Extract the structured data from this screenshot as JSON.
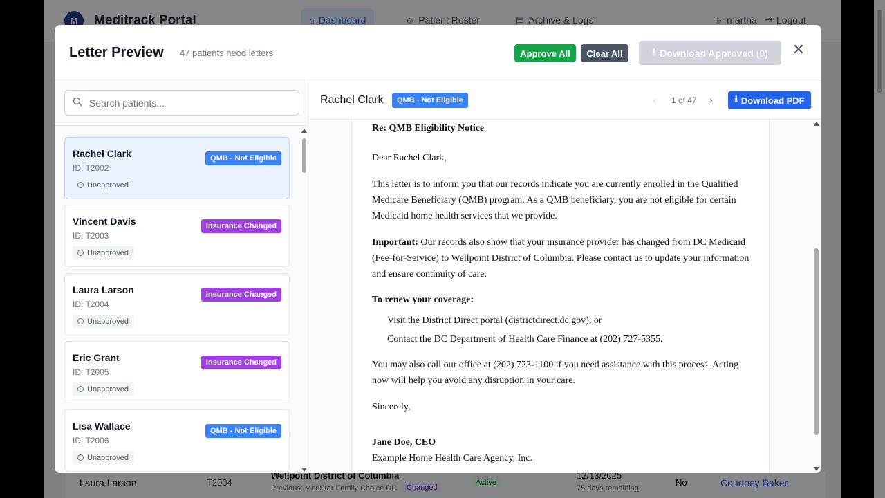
{
  "app": {
    "logo": "M",
    "title": "Meditrack Portal",
    "nav": [
      {
        "label": "Dashboard",
        "icon": "home-icon"
      },
      {
        "label": "Patient Roster",
        "icon": "user-icon"
      },
      {
        "label": "Archive & Logs",
        "icon": "archive-icon"
      }
    ],
    "user": "martha",
    "logout": "Logout",
    "bg_row": {
      "name": "Laura Larson",
      "id": "T2004",
      "insurance": "Wellpoint District of Columbia",
      "previous": "Previous: MedStar Family Choice DC",
      "changed": "Changed",
      "status": "Active",
      "date": "12/13/2025",
      "remaining": "75 days remaining",
      "flag": "No",
      "staff": "Courtney Baker"
    }
  },
  "modal": {
    "title": "Letter Preview",
    "subtitle": "47 patients need letters",
    "approve_all": "Approve All",
    "clear_all": "Clear All",
    "download_approved": "Download Approved (0)",
    "close": "✕"
  },
  "search": {
    "placeholder": "Search patients...",
    "value": ""
  },
  "patients": [
    {
      "name": "Rachel Clark",
      "id": "ID: T2002",
      "status": "Unapproved",
      "badge": "QMB - Not Eligible",
      "badge_color": "#3b82f6",
      "selected": true
    },
    {
      "name": "Vincent Davis",
      "id": "ID: T2003",
      "status": "Unapproved",
      "badge": "Insurance Changed",
      "badge_color": "#a23fe0",
      "selected": false
    },
    {
      "name": "Laura Larson",
      "id": "ID: T2004",
      "status": "Unapproved",
      "badge": "Insurance Changed",
      "badge_color": "#a23fe0",
      "selected": false
    },
    {
      "name": "Eric Grant",
      "id": "ID: T2005",
      "status": "Unapproved",
      "badge": "Insurance Changed",
      "badge_color": "#a23fe0",
      "selected": false
    },
    {
      "name": "Lisa Wallace",
      "id": "ID: T2006",
      "status": "Unapproved",
      "badge": "QMB - Not Eligible",
      "badge_color": "#3b82f6",
      "selected": false
    }
  ],
  "preview": {
    "name": "Rachel Clark",
    "badge": "QMB - Not Eligible",
    "page": "1 of 47",
    "download_pdf": "Download PDF",
    "letter": {
      "re": "Re: QMB Eligibility Notice",
      "greeting": "Dear Rachel Clark,",
      "p1": "This letter is to inform you that our records indicate you are currently enrolled in the Qualified Medicare Beneficiary (QMB) program. As a QMB beneficiary, you are not eligible for certain Medicaid home health services that we provide.",
      "important_label": "Important:",
      "important_text": " Our records also show that your insurance provider has changed from DC Medicaid (Fee-for-Service) to Wellpoint District of Columbia. Please contact us to update your information and ensure continuity of care.",
      "renew_heading": "To renew your coverage:",
      "renew_1": "Visit the District Direct portal (districtdirect.dc.gov), or",
      "renew_2": "Contact the DC Department of Health Care Finance at (202) 727-5355.",
      "p3": "You may also call our office at (202) 723-1100 if you need assistance with this process. Acting now will help you avoid any disruption in your care.",
      "closing": "Sincerely,",
      "signer": "Jane Doe, CEO",
      "agency": "Example Home Health Care Agency, Inc."
    }
  },
  "colors": {
    "primary": "#2563eb",
    "approve": "#16a34a",
    "clear": "#4b5563",
    "qmb_badge": "#3b82f6",
    "insurance_badge": "#a23fe0"
  }
}
